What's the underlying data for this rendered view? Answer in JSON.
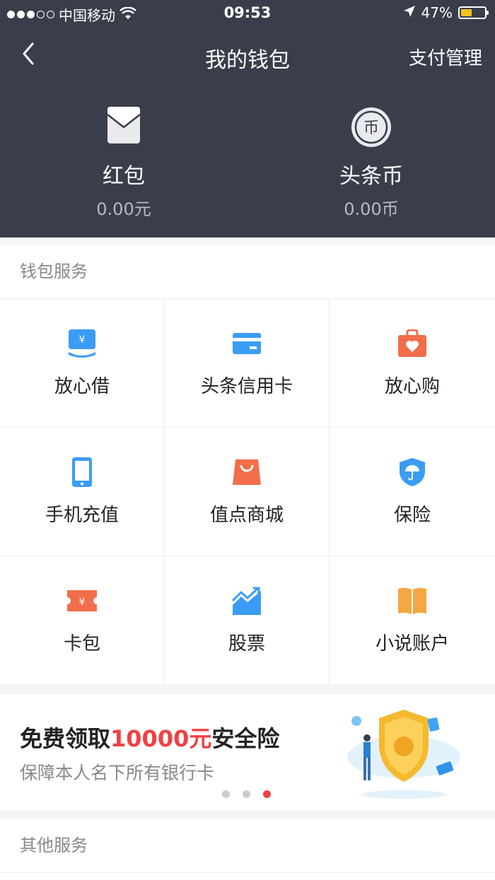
{
  "status": {
    "carrier": "中国移动",
    "time": "09:53",
    "battery": "47%",
    "battery_level": 0.47
  },
  "nav": {
    "title": "我的钱包",
    "right_action": "支付管理"
  },
  "wallet": [
    {
      "name": "红包",
      "value": "0.00元",
      "icon": "red-envelope-icon"
    },
    {
      "name": "头条币",
      "value": "0.00币",
      "icon": "coin-icon"
    }
  ],
  "services": {
    "title": "钱包服务",
    "items": [
      {
        "label": "放心借",
        "icon": "loan-icon",
        "color": "#3b9cf5"
      },
      {
        "label": "头条信用卡",
        "icon": "credit-card-icon",
        "color": "#3b9cf5"
      },
      {
        "label": "放心购",
        "icon": "shopping-bag-heart-icon",
        "color": "#f26d4a"
      },
      {
        "label": "手机充值",
        "icon": "phone-icon",
        "color": "#3b9cf5"
      },
      {
        "label": "值点商城",
        "icon": "shopping-bag-icon",
        "color": "#f26d4a"
      },
      {
        "label": "保险",
        "icon": "shield-umbrella-icon",
        "color": "#3b9cf5"
      },
      {
        "label": "卡包",
        "icon": "ticket-icon",
        "color": "#f26d4a"
      },
      {
        "label": "股票",
        "icon": "stock-chart-icon",
        "color": "#3b9cf5"
      },
      {
        "label": "小说账户",
        "icon": "book-icon",
        "color": "#f5a742"
      }
    ]
  },
  "banner": {
    "title_pre": "免费领取",
    "title_highlight": "10000元",
    "title_post": "安全险",
    "subtitle": "保障本人名下所有银行卡",
    "pages": 3,
    "active_page": 3
  },
  "other": {
    "title": "其他服务"
  },
  "colors": {
    "header_bg": "#3a3e4b",
    "accent": "#f04142"
  }
}
